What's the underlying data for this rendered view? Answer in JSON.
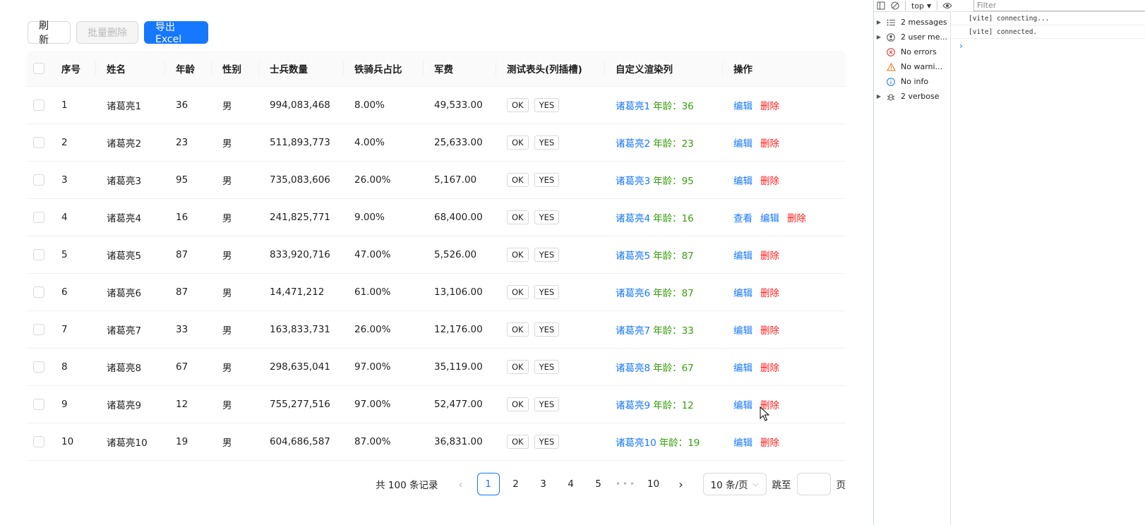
{
  "toolbar": {
    "refresh_label": "刷 新",
    "batch_delete_label": "批量删除",
    "export_label": "导出Excel"
  },
  "table": {
    "headers": [
      "序号",
      "姓名",
      "年龄",
      "性别",
      "士兵数量",
      "铁骑兵占比",
      "军费",
      "测试表头(列插槽)",
      "自定义渲染列",
      "操作"
    ],
    "age_prefix": "年龄：",
    "rows": [
      {
        "idx": "1",
        "name": "诸葛亮1",
        "age": "36",
        "sex": "男",
        "soldiers": "994,083,468",
        "cavalry": "8.00%",
        "fee": "49,533.00",
        "b1": "OK",
        "b2": "YES",
        "ops": [
          "编辑",
          "删除"
        ]
      },
      {
        "idx": "2",
        "name": "诸葛亮2",
        "age": "23",
        "sex": "男",
        "soldiers": "511,893,773",
        "cavalry": "4.00%",
        "fee": "25,633.00",
        "b1": "OK",
        "b2": "YES",
        "ops": [
          "编辑",
          "删除"
        ]
      },
      {
        "idx": "3",
        "name": "诸葛亮3",
        "age": "95",
        "sex": "男",
        "soldiers": "735,083,606",
        "cavalry": "26.00%",
        "fee": "5,167.00",
        "b1": "OK",
        "b2": "YES",
        "ops": [
          "编辑",
          "删除"
        ]
      },
      {
        "idx": "4",
        "name": "诸葛亮4",
        "age": "16",
        "sex": "男",
        "soldiers": "241,825,771",
        "cavalry": "9.00%",
        "fee": "68,400.00",
        "b1": "OK",
        "b2": "YES",
        "ops": [
          "查看",
          "编辑",
          "删除"
        ]
      },
      {
        "idx": "5",
        "name": "诸葛亮5",
        "age": "87",
        "sex": "男",
        "soldiers": "833,920,716",
        "cavalry": "47.00%",
        "fee": "5,526.00",
        "b1": "OK",
        "b2": "YES",
        "ops": [
          "编辑",
          "删除"
        ]
      },
      {
        "idx": "6",
        "name": "诸葛亮6",
        "age": "87",
        "sex": "男",
        "soldiers": "14,471,212",
        "cavalry": "61.00%",
        "fee": "13,106.00",
        "b1": "OK",
        "b2": "YES",
        "ops": [
          "编辑",
          "删除"
        ]
      },
      {
        "idx": "7",
        "name": "诸葛亮7",
        "age": "33",
        "sex": "男",
        "soldiers": "163,833,731",
        "cavalry": "26.00%",
        "fee": "12,176.00",
        "b1": "OK",
        "b2": "YES",
        "ops": [
          "编辑",
          "删除"
        ]
      },
      {
        "idx": "8",
        "name": "诸葛亮8",
        "age": "67",
        "sex": "男",
        "soldiers": "298,635,041",
        "cavalry": "97.00%",
        "fee": "35,119.00",
        "b1": "OK",
        "b2": "YES",
        "ops": [
          "编辑",
          "删除"
        ]
      },
      {
        "idx": "9",
        "name": "诸葛亮9",
        "age": "12",
        "sex": "男",
        "soldiers": "755,277,516",
        "cavalry": "97.00%",
        "fee": "52,477.00",
        "b1": "OK",
        "b2": "YES",
        "ops": [
          "编辑",
          "删除"
        ]
      },
      {
        "idx": "10",
        "name": "诸葛亮10",
        "age": "19",
        "sex": "男",
        "soldiers": "604,686,587",
        "cavalry": "87.00%",
        "fee": "36,831.00",
        "b1": "OK",
        "b2": "YES",
        "ops": [
          "编辑",
          "删除"
        ]
      }
    ]
  },
  "pagination": {
    "total_text": "共 100 条记录",
    "pages": [
      "1",
      "2",
      "3",
      "4",
      "5"
    ],
    "ellipsis": "•••",
    "last_page": "10",
    "current": "1",
    "page_size": "10 条/页",
    "jump_label": "跳至",
    "page_suffix": "页"
  },
  "devtools": {
    "context": "top",
    "filter_placeholder": "Filter",
    "sidebar": [
      {
        "label": "2 messages",
        "icon": "list-icon",
        "expandable": true
      },
      {
        "label": "2 user me...",
        "icon": "user-icon",
        "expandable": true
      },
      {
        "label": "No errors",
        "icon": "error-icon",
        "expandable": false
      },
      {
        "label": "No warni...",
        "icon": "warning-icon",
        "expandable": false
      },
      {
        "label": "No info",
        "icon": "info-icon",
        "expandable": false
      },
      {
        "label": "2 verbose",
        "icon": "bug-icon",
        "expandable": true
      }
    ],
    "logs": [
      "[vite] connecting...",
      "[vite] connected."
    ]
  },
  "colors": {
    "primary": "#1677ff",
    "danger": "#ff2020",
    "success": "#389e0d"
  }
}
